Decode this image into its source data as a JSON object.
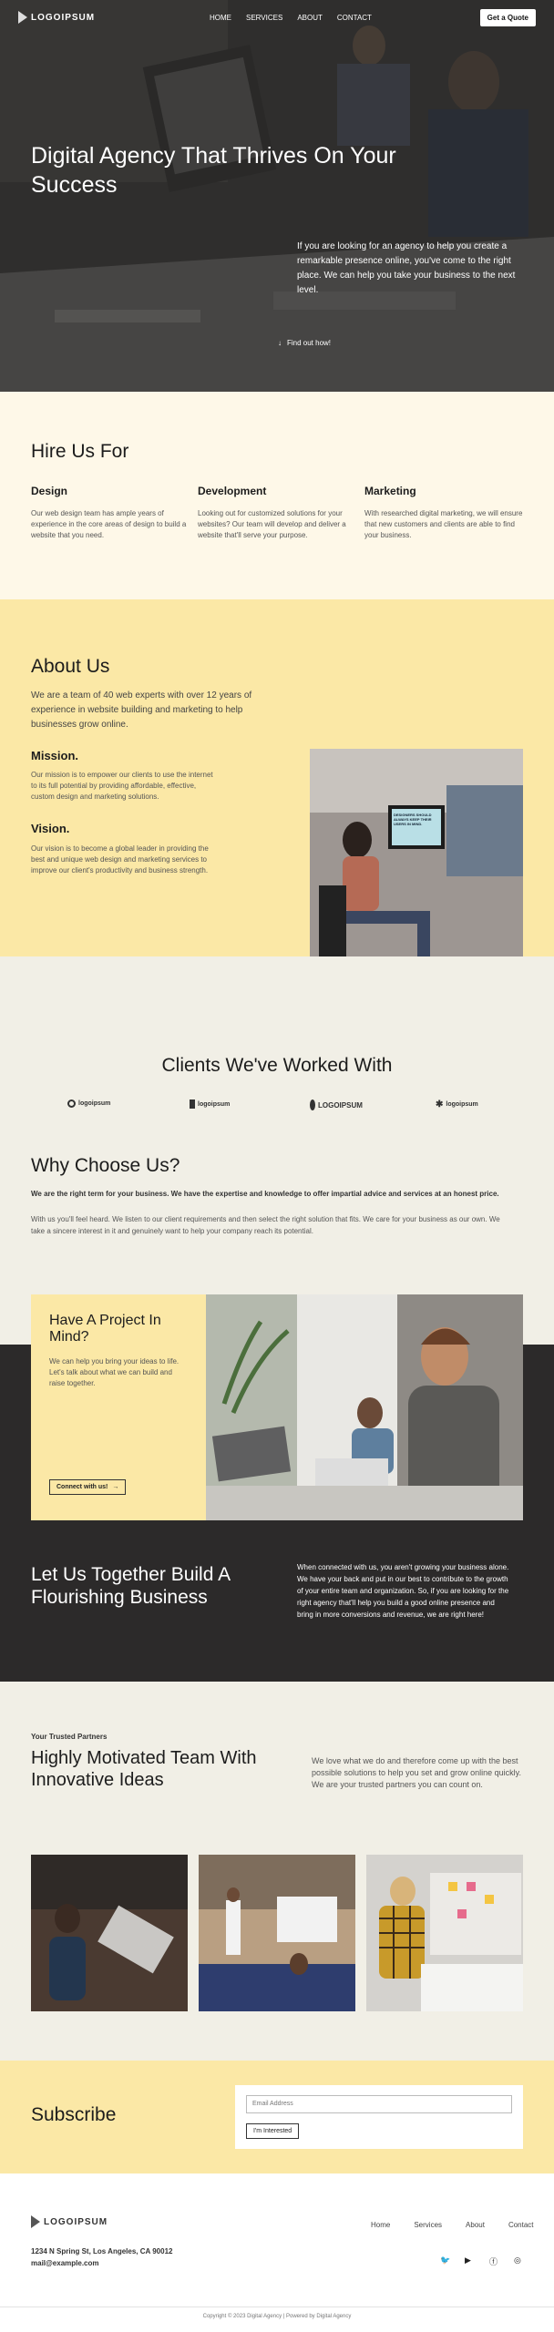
{
  "nav": {
    "logo": "LOGOIPSUM",
    "links": [
      "HOME",
      "SERVICES",
      "ABOUT",
      "CONTACT"
    ],
    "cta": "Get a Quote"
  },
  "hero": {
    "title": "Digital Agency That Thrives On Your Success",
    "text": "If you are looking for an agency to help you create a remarkable presence online, you've come to the right place. We can help you take your business to the next level.",
    "find_out": "Find out how!"
  },
  "hire": {
    "title": "Hire Us For",
    "cols": [
      {
        "title": "Design",
        "text": "Our web design team has ample years of experience in the core areas of design to build a website that you need."
      },
      {
        "title": "Development",
        "text": "Looking out for customized solutions for your websites? Our team will develop and deliver a website that'll serve your purpose."
      },
      {
        "title": "Marketing",
        "text": "With researched digital marketing, we will ensure that new customers and clients are able to find your business."
      }
    ]
  },
  "about": {
    "title": "About Us",
    "lead": "We are a team of 40 web experts with over 12 years of experience in website building and marketing to help businesses grow online.",
    "mission_title": "Mission.",
    "mission_text": "Our mission is to empower our clients to use the internet to its full potential by providing affordable, effective, custom design and marketing solutions.",
    "vision_title": "Vision.",
    "vision_text": "Our vision is to become a global leader in providing the best and unique web design and marketing services to improve our client's productivity and business strength.",
    "screen_text": "DESIGNERS SHOULD ALWAYS KEEP THEIR USERS IN MIND."
  },
  "clients": {
    "title": "Clients We've Worked With",
    "logos": [
      "logoipsum",
      "logoipsum",
      "LOGOIPSUM",
      "logoipsum"
    ]
  },
  "why": {
    "title": "Why Choose Us?",
    "bold": "We are the right term for your business. We have the expertise and knowledge to offer impartial advice and services at an honest price.",
    "text": "With us you'll feel heard. We listen to our client requirements and then select the right solution that fits. We care for your business as our own. We take a sincere interest in it and genuinely want to help your company reach its potential."
  },
  "project": {
    "title": "Have A Project In Mind?",
    "text": "We can help you bring your ideas to life. Let's talk about what we can build and raise together.",
    "cta": "Connect with us!"
  },
  "together": {
    "title": "Let Us Together Build A Flourishing Business",
    "text": "When connected with us, you aren't growing your business alone. We have your back and put in our best to contribute to the growth of your entire team and organization. So, if you are looking for the right agency that'll help you build a good online presence and bring in more conversions and revenue, we are right here!"
  },
  "team": {
    "kicker": "Your Trusted Partners",
    "title": "Highly Motivated Team With Innovative Ideas",
    "text": "We love what we do and therefore come up with the best possible solutions to help you set and grow online quickly. We are your trusted partners you can count on."
  },
  "subscribe": {
    "title": "Subscribe",
    "placeholder": "Email Address",
    "cta": "I'm Interested"
  },
  "footer": {
    "logo": "LOGOIPSUM",
    "links": [
      "Home",
      "Services",
      "About",
      "Contact"
    ],
    "address": "1234 N Spring St, Los Angeles, CA 90012",
    "email": "mail@example.com",
    "social": [
      "twitter-icon",
      "youtube-icon",
      "facebook-icon",
      "instagram-icon"
    ],
    "copyright": "Copyright © 2023 Digital Agency | Powered by Digital Agency"
  },
  "colors": {
    "cream": "#fef8e8",
    "yellow": "#fbe8a6",
    "beige": "#f1efe6",
    "dark": "#2c2a2a"
  }
}
